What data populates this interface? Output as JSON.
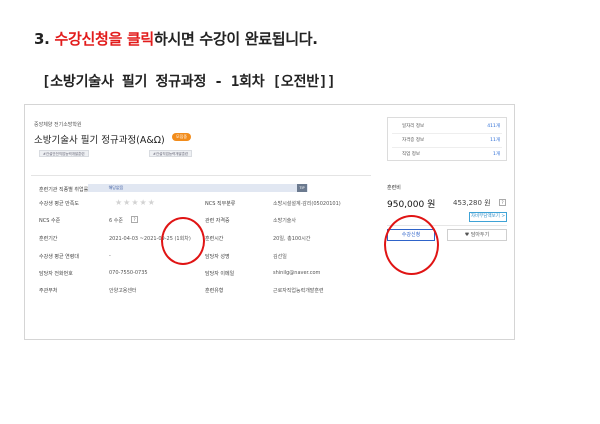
{
  "heading": {
    "prefix": "3. ",
    "highlight1": "수강신청을",
    "space": " ",
    "highlight2": "클릭",
    "suffix": "하시면 수강이 완료됩니다."
  },
  "subheading": "[소방기술사 필기 정규과정 - 1회차 [오전반]]",
  "course": {
    "org": "중앙체양 전기소방학원",
    "title": "소방기술사 필기 정규과정(A&Ω)",
    "status_badge": "모집중",
    "tags": [
      "#건설안전직업능력개발훈련",
      "#건설직업능력개발훈련"
    ]
  },
  "employment": {
    "label": "훈련기관 직종별 취업률",
    "bar_text": "해당없음",
    "tip": "TIP"
  },
  "details_left": [
    {
      "label": "수강생 평균 만족도",
      "value": "★★★★★"
    },
    {
      "label": "NCS 수준",
      "value": "6 수준",
      "help": "?"
    },
    {
      "label": "훈련기간",
      "value": "2021-04-03 ~2021-09-25 (1회차)"
    },
    {
      "label": "수강생 평균 연령대",
      "value": "-"
    },
    {
      "label": "담당자 전화번호",
      "value": "070-7550-0735"
    },
    {
      "label": "주관부처",
      "value": "안양고용센터"
    }
  ],
  "details_right": [
    {
      "label": "NCS 직무분류",
      "value": "소방시설설계·감리(05020101)"
    },
    {
      "label": "관련 자격증",
      "value": "소방기술사"
    },
    {
      "label": "훈련시간",
      "value": "20일, 총100시간"
    },
    {
      "label": "담당자 성명",
      "value": "김선일"
    },
    {
      "label": "담당자 이메일",
      "value": "shinilg@naver.com"
    },
    {
      "label": "훈련유형",
      "value": "근로자직업능력개발훈련"
    }
  ],
  "info_box": [
    {
      "key": "일자리 정보",
      "value": "411개"
    },
    {
      "key": "자격증 정보",
      "value": "11개"
    },
    {
      "key": "직업 정보",
      "value": "1개"
    }
  ],
  "fee": {
    "label": "훈련비",
    "price": "950,000 원",
    "original": "453,280 원",
    "help": "?",
    "selfpay_button": "자비부담액보기 >",
    "apply_button": "수강신청",
    "fav_button": "♥ 담아두기"
  },
  "colors": {
    "highlight": "#e21b1b",
    "circle": "#e01414",
    "brand_blue": "#2e63c9"
  }
}
